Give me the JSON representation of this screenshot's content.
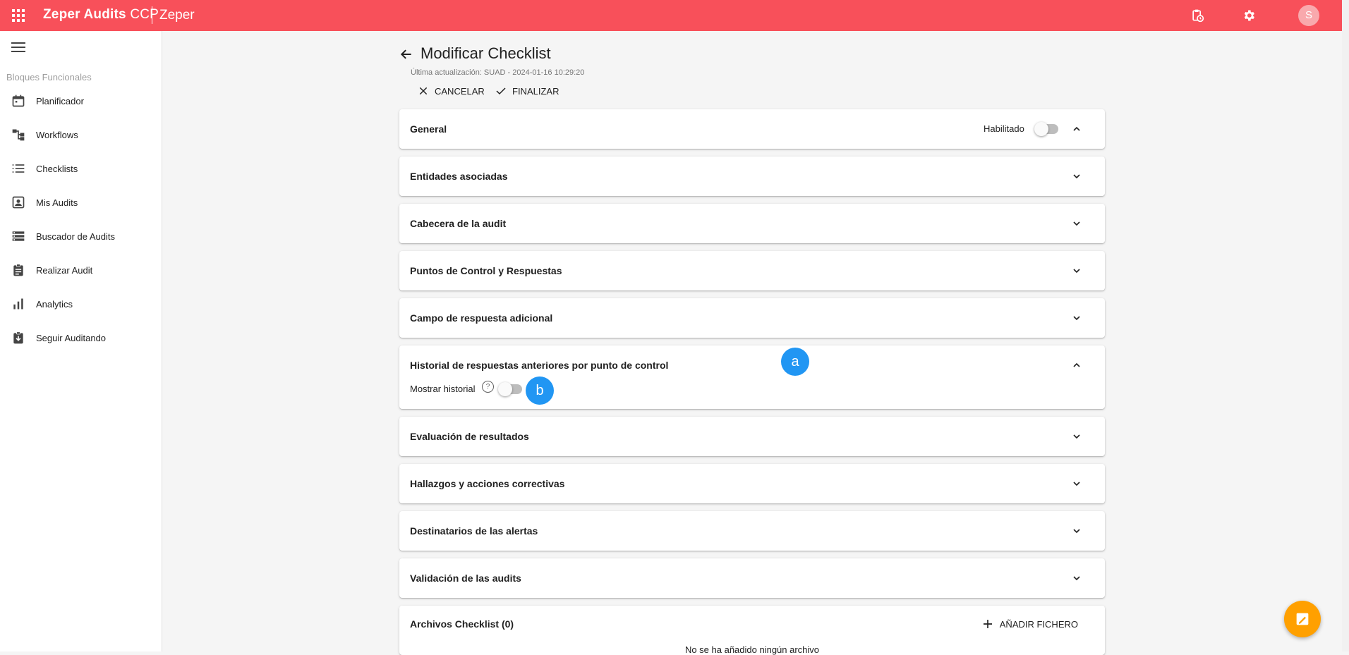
{
  "topbar": {
    "brand_bold": "Zeper Audits",
    "brand_light": "CCP",
    "tenant": "Zeper",
    "avatar_initial": "S",
    "color": "#f8505a"
  },
  "sidebar": {
    "heading": "Bloques Funcionales",
    "items": [
      {
        "label": "Planificador",
        "icon": "calendar-icon"
      },
      {
        "label": "Workflows",
        "icon": "workflow-icon"
      },
      {
        "label": "Checklists",
        "icon": "list-icon"
      },
      {
        "label": "Mis Audits",
        "icon": "contact-icon"
      },
      {
        "label": "Buscador de Audits",
        "icon": "storage-icon"
      },
      {
        "label": "Realizar Audit",
        "icon": "clipboard-icon"
      },
      {
        "label": "Analytics",
        "icon": "bar-chart-icon"
      },
      {
        "label": "Seguir Auditando",
        "icon": "download-box-icon"
      }
    ]
  },
  "main": {
    "title": "Modificar Checklist",
    "updated": "Última actualización: SUAD - 2024-01-16 10:29:20",
    "cancel_label": "CANCELAR",
    "finish_label": "FINALIZAR",
    "panels": [
      {
        "title": "General",
        "expanded": true,
        "toggle_label": "Habilitado"
      },
      {
        "title": "Entidades asociadas"
      },
      {
        "title": "Cabecera de la audit"
      },
      {
        "title": "Puntos de Control y Respuestas"
      },
      {
        "title": "Campo de respuesta adicional"
      },
      {
        "title": "Historial de respuestas anteriores por punto de control",
        "expanded": true,
        "field_label": "Mostrar historial"
      },
      {
        "title": "Evaluación de resultados"
      },
      {
        "title": "Hallazgos y acciones correctivas"
      },
      {
        "title": "Destinatarios de las alertas"
      },
      {
        "title": "Validación de las audits"
      },
      {
        "title": "Archivos Checklist (0)",
        "button": "AÑADIR FICHERO",
        "empty": "No se ha añadido ningún archivo"
      }
    ]
  },
  "markers": {
    "a": "a",
    "b": "b"
  },
  "accent_marker": "#2196f3",
  "fab_color": "#ffa000"
}
